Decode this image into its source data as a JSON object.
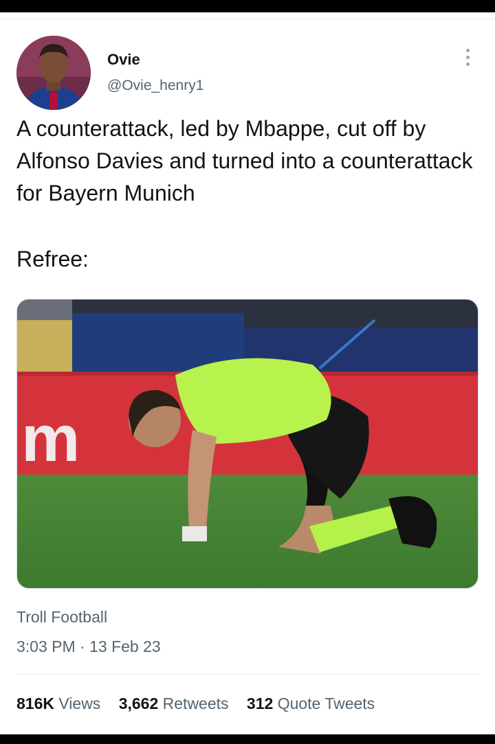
{
  "author": {
    "display_name": "Ovie",
    "handle": "@Ovie_henry1"
  },
  "tweet": {
    "text": "A counterattack, led by Mbappe, cut off by Alfonso Davies and turned into a counterattack for Bayern Munich",
    "caption": "Refree:",
    "source": "Troll Football",
    "timestamp": "3:03 PM · 13 Feb 23"
  },
  "media": {
    "banner_text": "m",
    "icon": "photo-referee-kneeling"
  },
  "stats": [
    {
      "count": "816K",
      "label": "Views"
    },
    {
      "count": "3,662",
      "label": "Retweets"
    },
    {
      "count": "312",
      "label": "Quote Tweets"
    }
  ],
  "colors": {
    "text_primary": "#0f1419",
    "text_secondary": "#536471",
    "divider": "#e3e6e9"
  }
}
